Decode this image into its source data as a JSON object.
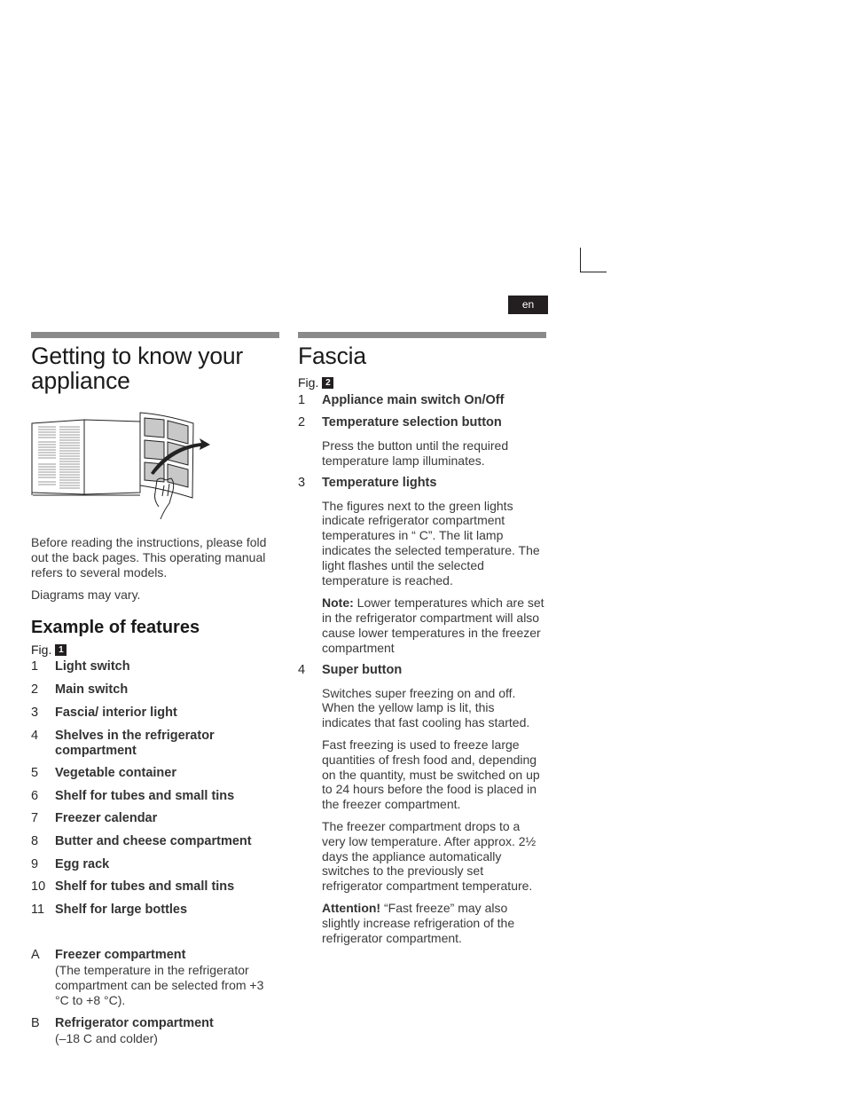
{
  "page": {
    "language_badge": "en"
  },
  "left": {
    "title": "Getting to know your appliance",
    "intro": "Before reading the instructions, please fold out the back pages. This operating manual refers to several models.",
    "note": "Diagrams may vary.",
    "features_heading": "Example of features",
    "fig_label": "Fig.",
    "fig_number": "1",
    "items": [
      {
        "num": "1",
        "label": "Light switch"
      },
      {
        "num": "2",
        "label": "Main switch"
      },
      {
        "num": "3",
        "label": "Fascia/ interior light"
      },
      {
        "num": "4",
        "label": "Shelves in the refrigerator compartment"
      },
      {
        "num": "5",
        "label": "Vegetable container"
      },
      {
        "num": "6",
        "label": "Shelf for tubes and small tins"
      },
      {
        "num": "7",
        "label": "Freezer calendar"
      },
      {
        "num": "8",
        "label": "Butter and cheese compartment"
      },
      {
        "num": "9",
        "label": "Egg rack"
      },
      {
        "num": "10",
        "label": "Shelf for tubes and small tins"
      },
      {
        "num": "11",
        "label": "Shelf for large bottles"
      }
    ],
    "compartments": [
      {
        "key": "A",
        "label": "Freezer compartment",
        "desc": "(The temperature in the refrigerator compartment can be selected from +3 °C to +8 °C)."
      },
      {
        "key": "B",
        "label": "Refrigerator compartment",
        "desc": "(–18  C and colder)"
      }
    ]
  },
  "right": {
    "title": "Fascia",
    "fig_label": "Fig.",
    "fig_number": "2",
    "items": [
      {
        "num": "1",
        "label": "Appliance main switch On/Off"
      },
      {
        "num": "2",
        "label": "Temperature selection button",
        "paras": [
          "Press the button until the required temperature lamp illuminates."
        ]
      },
      {
        "num": "3",
        "label": "Temperature lights",
        "paras": [
          "The figures next to the green lights indicate refrigerator compartment temperatures in “ C”. The lit lamp indicates the selected temperature. The light flashes until the selected temperature is reached."
        ],
        "note_label": "Note:",
        "note_text": " Lower temperatures which are set in the refrigerator compartment will also cause lower temperatures in the freezer compartment"
      },
      {
        "num": "4",
        "label": "Super button",
        "paras": [
          "Switches super freezing on and off. When the yellow lamp is lit, this indicates that fast cooling has started.",
          "Fast freezing is used to freeze large quantities of fresh food and, depending on the quantity, must be switched on up to 24 hours before the food is placed in the freezer compartment.",
          "The freezer compartment drops to a very low temperature. After approx. 2½ days the appliance automatically switches to the previously set refrigerator compartment temperature."
        ],
        "attention_label": "Attention!",
        "attention_text": " “Fast freeze” may also slightly increase refrigeration of the refrigerator compartment."
      }
    ]
  }
}
